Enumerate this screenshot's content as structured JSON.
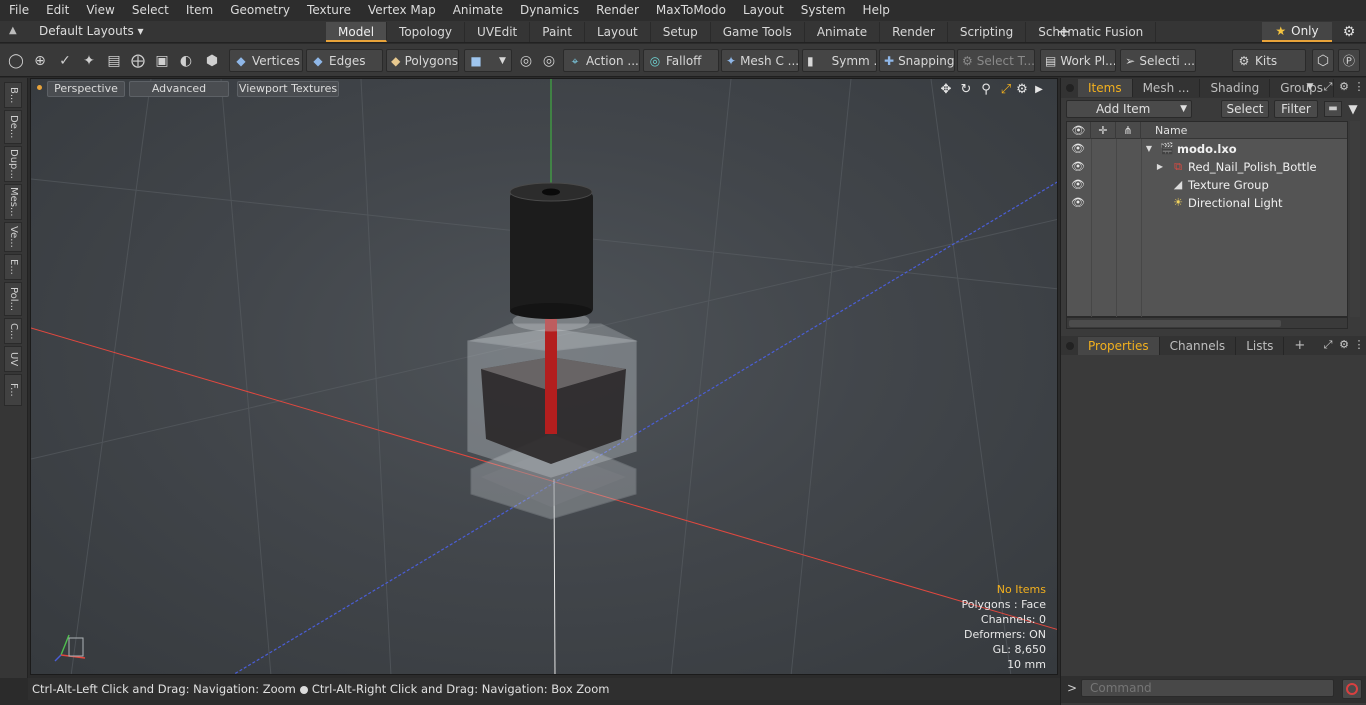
{
  "menu": [
    "File",
    "Edit",
    "View",
    "Select",
    "Item",
    "Geometry",
    "Texture",
    "Vertex Map",
    "Animate",
    "Dynamics",
    "Render",
    "MaxToModo",
    "Layout",
    "System",
    "Help"
  ],
  "layout_selector": "Default Layouts ▾",
  "tabs": [
    "Model",
    "Topology",
    "UVEdit",
    "Paint",
    "Layout",
    "Setup",
    "Game Tools",
    "Animate",
    "Render",
    "Scripting",
    "Schematic Fusion"
  ],
  "active_tab": "Model",
  "only_button": "Only",
  "toolbar": {
    "vertices": "Vertices",
    "edges": "Edges",
    "polygons": "Polygons",
    "action": "Action ...",
    "falloff": "Falloff",
    "mesh_c": "Mesh C ...",
    "symm": "Symm ...",
    "snapping": "Snapping",
    "select_t": "Select T...",
    "work_pl": "Work Pl...",
    "selecti": "Selecti ...",
    "kits": "Kits"
  },
  "left_strip": [
    "B...",
    "De...",
    "Dup...",
    "Mes...",
    "Ve...",
    "E...",
    "Pol...",
    "C...",
    "UV",
    "F..."
  ],
  "viewport": {
    "perspective": "Perspective",
    "advanced": "Advanced",
    "viewport_textures": "Viewport Textures",
    "info": {
      "no_items": "No Items",
      "polygons": "Polygons : Face",
      "channels": "Channels: 0",
      "deformers": "Deformers: ON",
      "gl": "GL: 8,650",
      "scale": "10 mm"
    },
    "colors": {
      "x_axis": "#e0483f",
      "y_axis": "#3fbf3f",
      "z_axis": "#4a5ed8",
      "cap": "#1c1c1c",
      "glass": "#c9cfd4",
      "liquid": "#2a2728",
      "rod": "#b31e1e"
    }
  },
  "status": {
    "left": "Ctrl-Alt-Left Click and Drag: Navigation: Zoom",
    "right": "Ctrl-Alt-Right Click and Drag: Navigation: Box Zoom"
  },
  "items_panel": {
    "tabs": [
      "Items",
      "Mesh ...",
      "Shading",
      "Groups"
    ],
    "active_tab": "Items",
    "add_item": "Add Item",
    "select": "Select",
    "filter": "Filter",
    "name_header": "Name",
    "rows": [
      {
        "label": "modo.lxo",
        "icon": "scene-icon"
      },
      {
        "label": "Red_Nail_Polish_Bottle",
        "icon": "mesh-locator-icon"
      },
      {
        "label": "Texture Group",
        "icon": "texture-group-icon"
      },
      {
        "label": "Directional Light",
        "icon": "directional-light-icon"
      }
    ]
  },
  "properties_panel": {
    "tabs": [
      "Properties",
      "Channels",
      "Lists"
    ],
    "active_tab": "Properties"
  },
  "command": {
    "placeholder": "Command",
    "prompt": ">"
  }
}
